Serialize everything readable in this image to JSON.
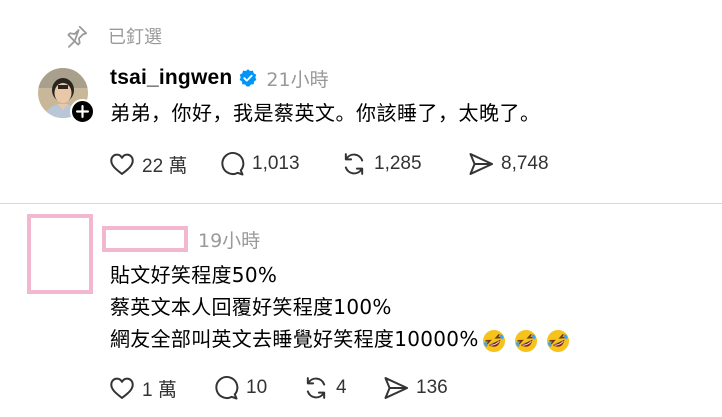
{
  "pinned": {
    "label": "已釘選",
    "icon": "pin-icon"
  },
  "post": {
    "username": "tsai_ingwen",
    "verified": true,
    "time": "21小時",
    "body": "弟弟，你好，我是蔡英文。你該睡了，太晚了。",
    "stats": {
      "likes": "22 萬",
      "comments": "1,013",
      "reposts": "1,285",
      "shares": "8,748"
    }
  },
  "reply": {
    "time": "19小時",
    "lines": [
      "貼文好笑程度50%",
      "蔡英文本人回覆好笑程度100%",
      "網友全部叫英文去睡覺好笑程度10000%"
    ],
    "emoji": [
      "rolling-laughing-icon",
      "rolling-laughing-icon",
      "rolling-laughing-icon"
    ],
    "stats": {
      "likes": "1 萬",
      "comments": "10",
      "reposts": "4",
      "shares": "136"
    }
  },
  "colors": {
    "muted": "#999999",
    "verified": "#0095f6",
    "redaction": "#f2b8cf",
    "divider": "#d9d9d9"
  }
}
